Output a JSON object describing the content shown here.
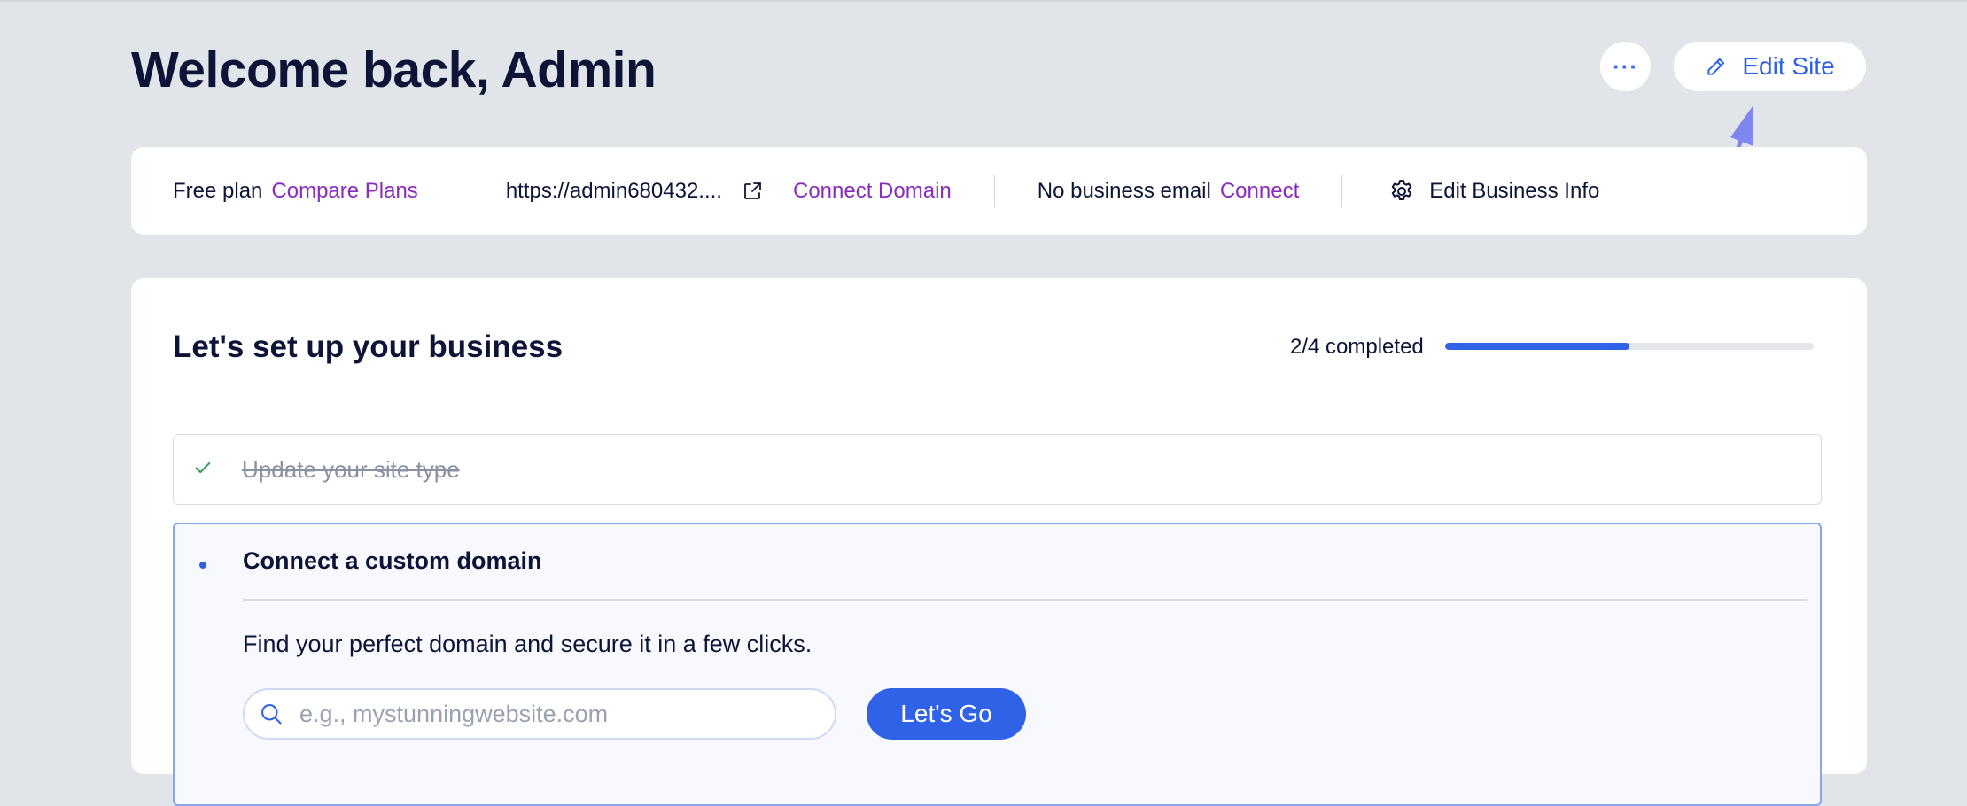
{
  "header": {
    "title": "Welcome back, Admin",
    "more_label": "···",
    "edit_site_label": "Edit Site"
  },
  "info_bar": {
    "plan_label": "Free plan",
    "compare_plans_label": "Compare Plans",
    "site_url": "https://admin680432....",
    "connect_domain_label": "Connect Domain",
    "email_label": "No business email",
    "connect_label": "Connect",
    "edit_business_info_label": "Edit Business Info"
  },
  "setup": {
    "title": "Let's set up your business",
    "progress_text": "2/4 completed",
    "progress_fraction": 0.5,
    "steps": [
      {
        "label": "Update your site type",
        "status": "completed"
      },
      {
        "label": "Connect a custom domain",
        "status": "active",
        "description": "Find your perfect domain and secure it in a few clicks.",
        "search_placeholder": "e.g., mystunningwebsite.com",
        "button_label": "Let's Go"
      }
    ]
  },
  "colors": {
    "accent": "#2f62e6",
    "link": "#8a2bbf",
    "background": "#e1e5ea",
    "success": "#3a9a5b",
    "annotation_arrow": "#7f86f2"
  },
  "icons": {
    "more": "more-dots-icon",
    "edit": "pencil-icon",
    "external": "external-link-icon",
    "settings": "gear-icon",
    "check": "check-icon",
    "search": "search-icon",
    "annotation": "arrow-annotation"
  }
}
